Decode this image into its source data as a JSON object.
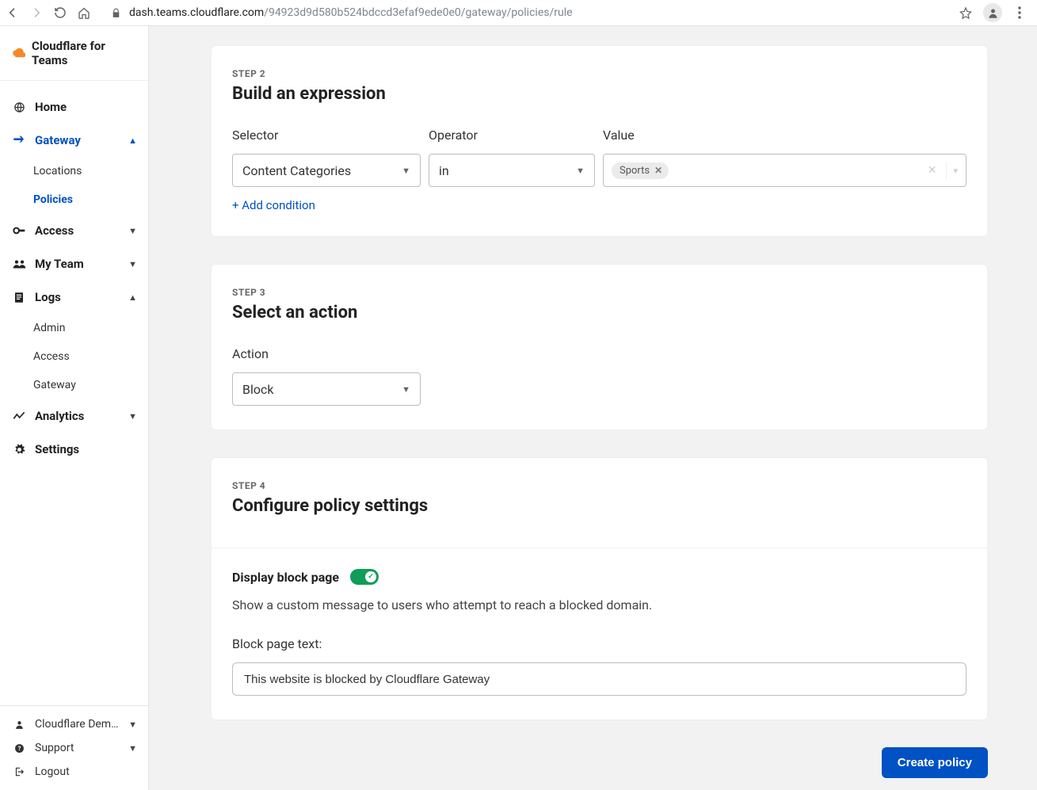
{
  "browser": {
    "url_host": "dash.teams.cloudflare.com",
    "url_rest": "/94923d9d580b524bdccd3efaf9ede0e0/gateway/policies/rule"
  },
  "sidebar": {
    "brand": "Cloudflare for Teams",
    "items": {
      "home": "Home",
      "gateway": "Gateway",
      "gateway_children": {
        "locations": "Locations",
        "policies": "Policies"
      },
      "access": "Access",
      "myteam": "My Team",
      "logs": "Logs",
      "logs_children": {
        "admin": "Admin",
        "access": "Access",
        "gateway": "Gateway"
      },
      "analytics": "Analytics",
      "settings": "Settings"
    },
    "footer": {
      "account": "Cloudflare Demo d…",
      "support": "Support",
      "logout": "Logout"
    }
  },
  "step2": {
    "label": "STEP 2",
    "title": "Build an expression",
    "selector_label": "Selector",
    "operator_label": "Operator",
    "value_label": "Value",
    "selector_value": "Content Categories",
    "operator_value": "in",
    "value_tag": "Sports",
    "add_condition": "+ Add condition"
  },
  "step3": {
    "label": "STEP 3",
    "title": "Select an action",
    "action_label": "Action",
    "action_value": "Block"
  },
  "step4": {
    "label": "STEP 4",
    "title": "Configure policy settings",
    "toggle_label": "Display block page",
    "toggle_on": true,
    "toggle_desc": "Show a custom message to users who attempt to reach a blocked domain.",
    "block_text_label": "Block page text:",
    "block_text_value": "This website is blocked by Cloudflare Gateway"
  },
  "actions": {
    "create": "Create policy"
  }
}
